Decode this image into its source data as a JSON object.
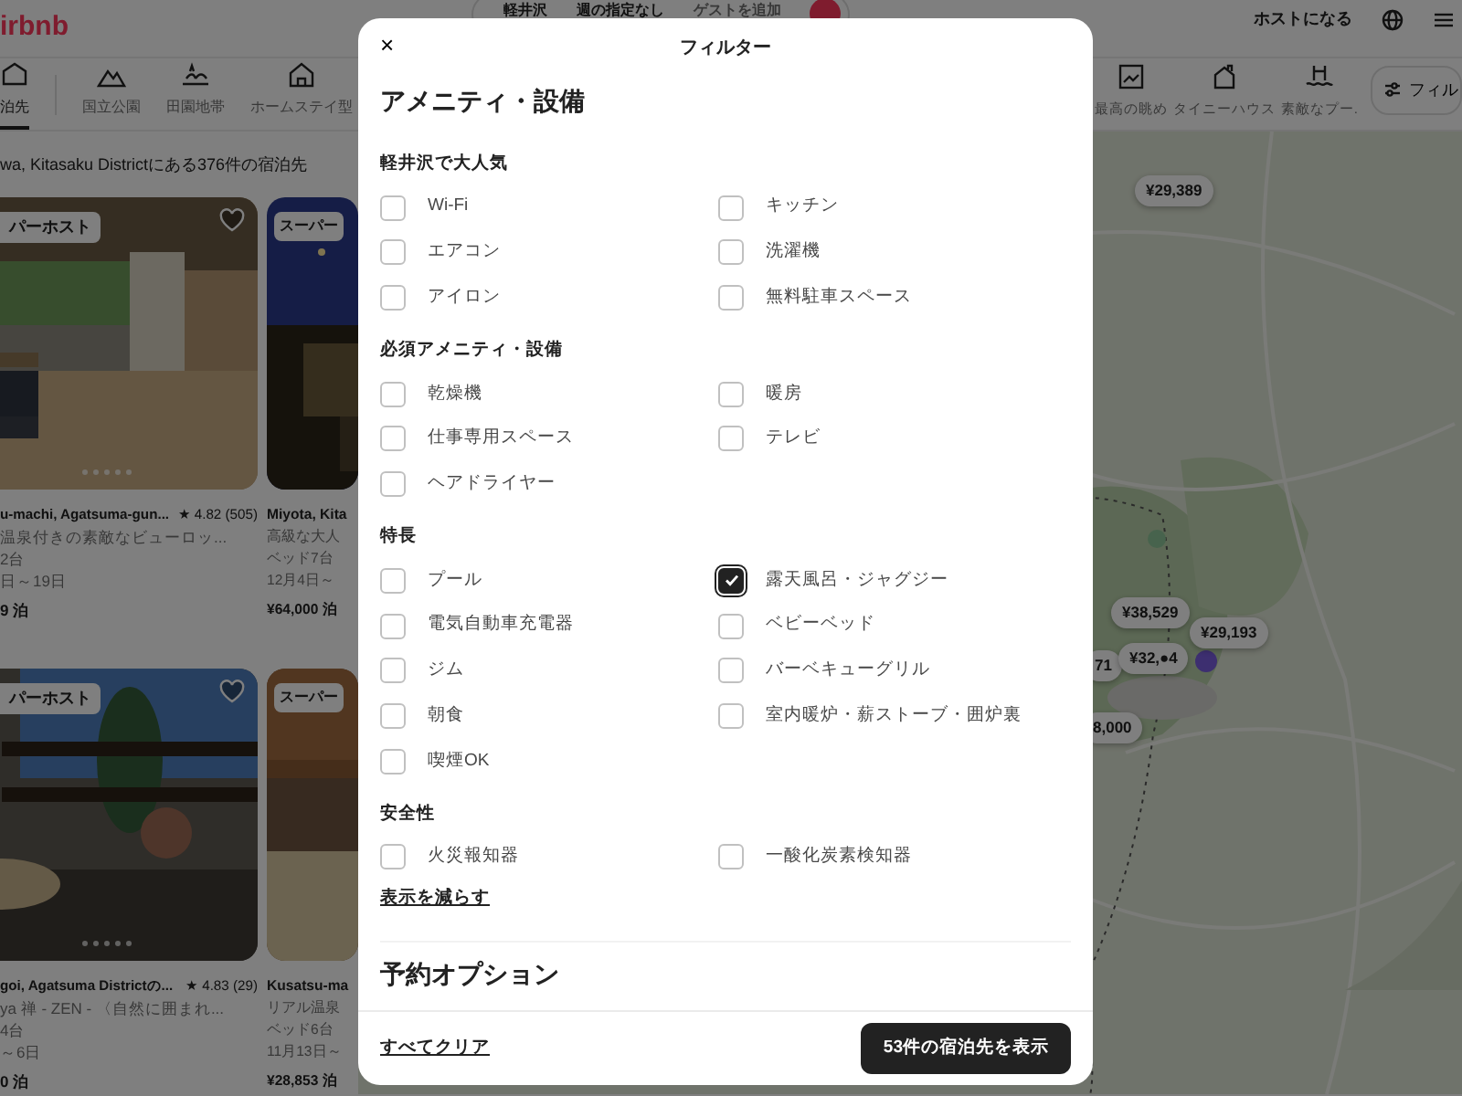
{
  "header": {
    "logo": "irbnb",
    "search": [
      "軽井沢",
      "週の指定なし",
      "ゲストを追加"
    ],
    "host_link": "ホストになる"
  },
  "categories": [
    {
      "label": "泊先",
      "selected": true
    },
    {
      "label": "国立公園",
      "selected": false
    },
    {
      "label": "田園地帯",
      "selected": false
    },
    {
      "label": "ホームステイ型",
      "selected": false
    },
    {
      "label": "最高の眺め",
      "selected": false
    },
    {
      "label": "タイニーハウス",
      "selected": false
    },
    {
      "label": "素敵なプー.",
      "selected": false
    }
  ],
  "filter_button": "フィル",
  "results_title": "wa, Kitasaku Districtにある376件の宿泊先",
  "listings": [
    {
      "badge": "パーホスト",
      "favorite": true,
      "location": "u-machi, Agatsuma-gun...",
      "rating": "★ 4.82 (505)",
      "title": "温泉付きの素敵なビューロッ...",
      "beds": "2台",
      "dates": "日～19日",
      "price": "9 泊"
    },
    {
      "badge": "スーパー",
      "location": "Miyota, Kita",
      "title": "高級な大人",
      "beds": "ベッド7台",
      "dates": "12月4日～",
      "price": "¥64,000 泊"
    },
    {
      "badge": "パーホスト",
      "favorite": true,
      "location": "goi, Agatsuma Districtの...",
      "rating": "★ 4.83 (29)",
      "title": "ya 禅 - ZEN - 〈自然に囲まれ...",
      "beds": "4台",
      "dates": "～6日",
      "price": "0 泊"
    },
    {
      "badge": "スーパー",
      "location": "Kusatsu-ma",
      "title": "リアル温泉",
      "beds": "ベッド6台",
      "dates": "11月13日～",
      "price": "¥28,853 泊"
    }
  ],
  "map_pins": [
    {
      "label": "¥29,389"
    },
    {
      "label": "71"
    },
    {
      "label": "8,000"
    },
    {
      "label": "¥38,529"
    },
    {
      "label": "¥32,●4"
    },
    {
      "label": "¥29,193"
    }
  ],
  "modal": {
    "close": "×",
    "title": "フィルター",
    "heading": "アメニティ・設備",
    "sections": [
      {
        "title": "軽井沢で大人気",
        "options": [
          {
            "label": "Wi-Fi",
            "checked": false
          },
          {
            "label": "キッチン",
            "checked": false
          },
          {
            "label": "エアコン",
            "checked": false
          },
          {
            "label": "洗濯機",
            "checked": false
          },
          {
            "label": "アイロン",
            "checked": false
          },
          {
            "label": "無料駐車スペース",
            "checked": false
          }
        ]
      },
      {
        "title": "必須アメニティ・設備",
        "options": [
          {
            "label": "乾燥機",
            "checked": false
          },
          {
            "label": "暖房",
            "checked": false
          },
          {
            "label": "仕事専用スペース",
            "checked": false
          },
          {
            "label": "テレビ",
            "checked": false
          },
          {
            "label": "ヘアドライヤー",
            "checked": false
          }
        ]
      },
      {
        "title": "特長",
        "options": [
          {
            "label": "プール",
            "checked": false
          },
          {
            "label": "露天風呂・ジャグジー",
            "checked": true
          },
          {
            "label": "電気自動車充電器",
            "checked": false
          },
          {
            "label": "ベビーベッド",
            "checked": false
          },
          {
            "label": "ジム",
            "checked": false
          },
          {
            "label": "バーベキューグリル",
            "checked": false
          },
          {
            "label": "朝食",
            "checked": false
          },
          {
            "label": "室内暖炉・薪ストーブ・囲炉裏",
            "checked": false
          },
          {
            "label": "喫煙OK",
            "checked": false
          }
        ]
      },
      {
        "title": "安全性",
        "options": [
          {
            "label": "火災報知器",
            "checked": false
          },
          {
            "label": "一酸化炭素検知器",
            "checked": false
          }
        ]
      }
    ],
    "less_link": "表示を減らす",
    "next_heading": "予約オプション",
    "clear_link": "すべてクリア",
    "show_button": "53件の宿泊先を表示"
  }
}
